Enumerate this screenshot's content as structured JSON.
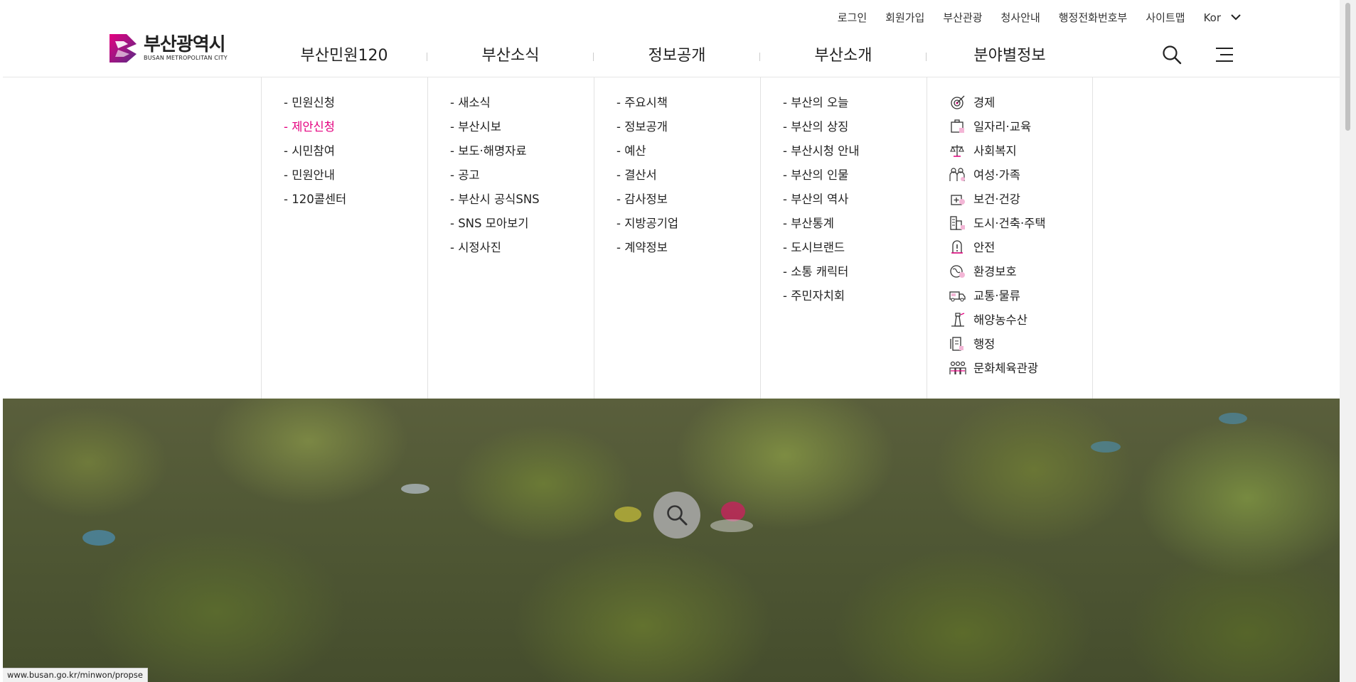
{
  "util_links": [
    "로그인",
    "회원가입",
    "부산관광",
    "청사안내",
    "행정전화번호부",
    "사이트맵"
  ],
  "language": "Kor",
  "logo": {
    "ko": "부산광역시",
    "en": "BUSAN METROPOLITAN CITY"
  },
  "gnb": [
    "부산민원120",
    "부산소식",
    "정보공개",
    "부산소개",
    "분야별정보"
  ],
  "mega": {
    "col1": [
      "- 민원신청",
      "- 제안신청",
      "- 시민참여",
      "- 민원안내",
      "- 120콜센터"
    ],
    "col2": [
      "- 새소식",
      "- 부산시보",
      "- 보도·해명자료",
      "- 공고",
      "- 부산시 공식SNS",
      "- SNS 모아보기",
      "- 시정사진"
    ],
    "col3": [
      "- 주요시책",
      "- 정보공개",
      "- 예산",
      "- 결산서",
      "- 감사정보",
      "- 지방공기업",
      "- 계약정보"
    ],
    "col4": [
      "- 부산의 오늘",
      "- 부산의 상징",
      "- 부산시청 안내",
      "- 부산의 인물",
      "- 부산의 역사",
      "- 부산통계",
      "- 도시브랜드",
      "- 소통 캐릭터",
      "- 주민자치회"
    ],
    "col5": [
      "경제",
      "일자리·교육",
      "사회복지",
      "여성·가족",
      "보건·건강",
      "도시·건축·주택",
      "안전",
      "환경보호",
      "교통·물류",
      "해양농수산",
      "행정",
      "문화체육관광"
    ]
  },
  "status_url": "www.busan.go.kr/minwon/propse",
  "colors": {
    "accent": "#e4007f",
    "logo_purple": "#5b2a86"
  }
}
